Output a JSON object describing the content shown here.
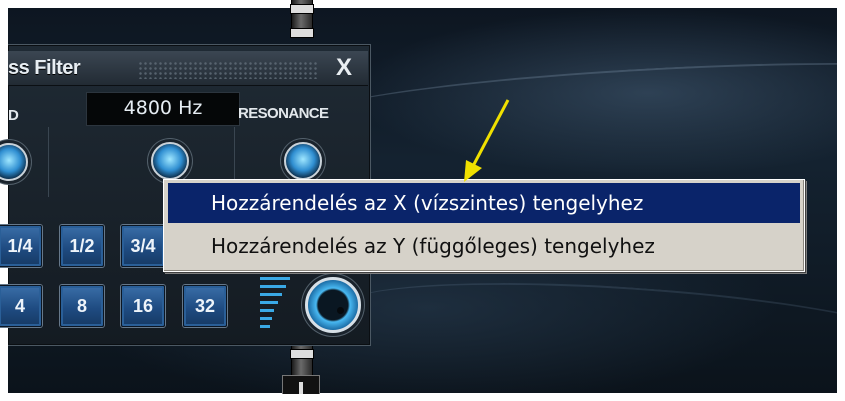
{
  "filter_panel": {
    "title": "ss Filter",
    "close_label": "X",
    "frequency_display": "4800 Hz",
    "left_label": "D",
    "resonance_label": "RESONANCE",
    "buttons_row1": [
      "1/4",
      "1/2",
      "3/4"
    ],
    "buttons_row2": [
      "4",
      "8",
      "16",
      "32"
    ]
  },
  "context_menu": {
    "items": [
      {
        "label": "Hozzárendelés az X (vízszintes) tengelyhez",
        "highlighted": true
      },
      {
        "label": "Hozzárendelés az Y (függőleges) tengelyhez",
        "highlighted": false
      }
    ]
  },
  "colors": {
    "menu_highlight": "#0a246a",
    "menu_background": "#d6d2c9",
    "annotation_arrow": "#f0e000",
    "knob_accent": "#2f8ed1"
  },
  "icons": {
    "close": "close-icon",
    "annotation": "arrow-icon",
    "knob": "knob-icon"
  }
}
